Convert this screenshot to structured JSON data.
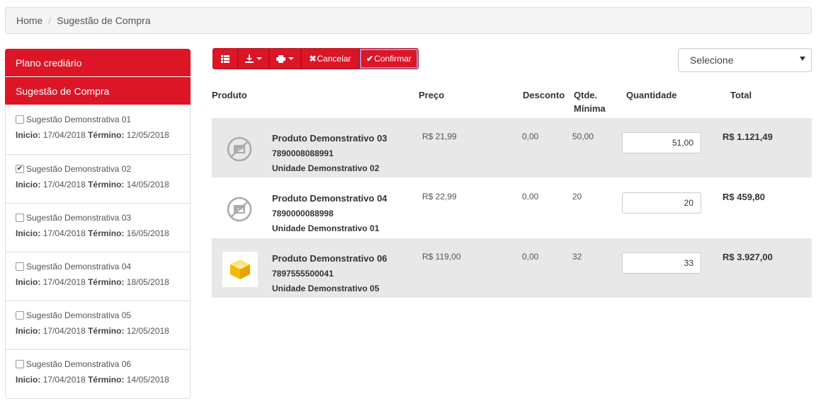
{
  "breadcrumb": {
    "home": "Home",
    "current": "Sugestão de Compra"
  },
  "sidebar": {
    "credit_plan": "Plano crediário",
    "purchase_suggestion": "Sugestão de Compra",
    "items": [
      {
        "name": "Sugestão Demonstrativa 01",
        "start_label": "Inicio:",
        "start": "17/04/2018",
        "end_label": "Término:",
        "end": "12/05/2018",
        "checked": false
      },
      {
        "name": "Sugestão Demonstrativa 02",
        "start_label": "Inicio:",
        "start": "17/04/2018",
        "end_label": "Término:",
        "end": "14/05/2018",
        "checked": true
      },
      {
        "name": "Sugestão Demonstrativa 03",
        "start_label": "Inicio:",
        "start": "17/04/2018",
        "end_label": "Término:",
        "end": "16/05/2018",
        "checked": false
      },
      {
        "name": "Sugestão Demonstrativa 04",
        "start_label": "Inicio:",
        "start": "17/04/2018",
        "end_label": "Término:",
        "end": "18/05/2018",
        "checked": false
      },
      {
        "name": "Sugestão Demonstrativa 05",
        "start_label": "Inicio:",
        "start": "17/04/2018",
        "end_label": "Término:",
        "end": "12/05/2018",
        "checked": false
      },
      {
        "name": "Sugestão Demonstrativa 06",
        "start_label": "Inicio:",
        "start": "17/04/2018",
        "end_label": "Término:",
        "end": "14/05/2018",
        "checked": false
      }
    ]
  },
  "toolbar": {
    "grid_icon": "grid-icon",
    "download_icon": "download-icon",
    "print_icon": "print-icon",
    "cancel_label": "Cancelar",
    "confirm_label": "Confirmar"
  },
  "select": {
    "value": "Selecione"
  },
  "table": {
    "headers": {
      "product": "Produto",
      "price": "Preço",
      "discount": "Desconto",
      "min_qty_1": "Qtde.",
      "min_qty_2": "Mínima",
      "quantity": "Quantidade",
      "total": "Total"
    },
    "rows": [
      {
        "name": "Produto Demonstrativo 03",
        "code": "7890008088991",
        "unit": "Unidade Demonstrativo 02",
        "price": "R$ 21,99",
        "discount": "0,00",
        "min_qty": "50,00",
        "quantity": "51,00",
        "total": "R$ 1.121,49",
        "image": "no-image-icon"
      },
      {
        "name": "Produto Demonstrativo 04",
        "code": "7890000088998",
        "unit": "Unidade Demonstrativo 01",
        "price": "R$ 22,99",
        "discount": "0,00",
        "min_qty": "20",
        "quantity": "20",
        "total": "R$ 459,80",
        "image": "no-image-icon"
      },
      {
        "name": "Produto Demonstrativo 06",
        "code": "7897555500041",
        "unit": "Unidade Demonstrativo 05",
        "price": "R$ 119,00",
        "discount": "0,00",
        "min_qty": "32",
        "quantity": "33",
        "total": "R$ 3.927,00",
        "image": "box-icon"
      }
    ]
  },
  "colors": {
    "accent": "#dc1527",
    "row_shade": "#e8e8e8"
  }
}
